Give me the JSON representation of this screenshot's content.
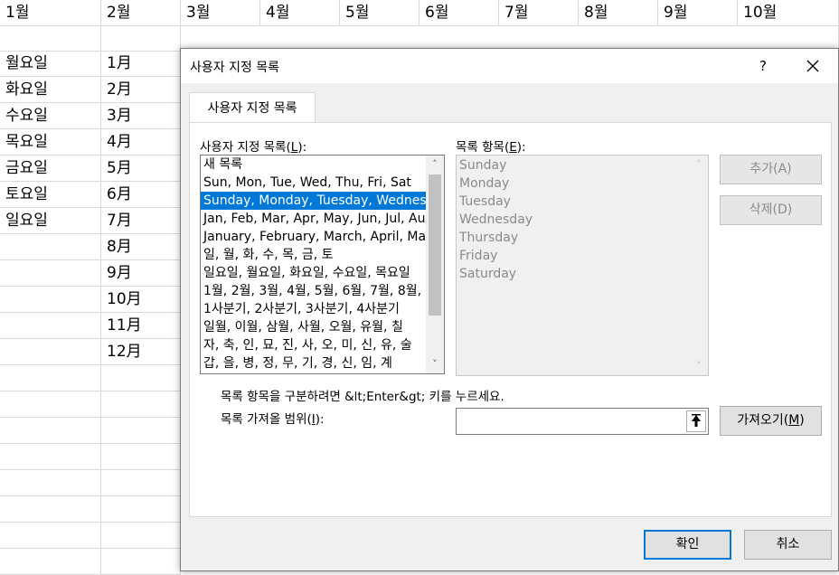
{
  "sheet": {
    "header_row": [
      "1월",
      "2월",
      "3월",
      "4월",
      "5월",
      "6월",
      "7월",
      "8월",
      "9월",
      "10월"
    ],
    "col_a": [
      "월요일",
      "화요일",
      "수요일",
      "목요일",
      "금요일",
      "토요일",
      "일요일"
    ],
    "col_b": [
      "1月",
      "2月",
      "3月",
      "4月",
      "5月",
      "6月",
      "7月",
      "8月",
      "9月",
      "10月",
      "11月",
      "12月"
    ]
  },
  "dialog": {
    "title": "사용자 지정 목록",
    "help": "?",
    "tab": "사용자 지정 목록",
    "lists_label": "사용자 지정 목록(",
    "lists_label_key": "L",
    "lists_label_tail": "):",
    "lists": [
      "새 목록",
      "Sun, Mon, Tue, Wed, Thu, Fri, Sat",
      "Sunday, Monday, Tuesday, Wednesday, Thursday, Friday, Saturday",
      "Jan, Feb, Mar, Apr, May, Jun, Jul, Aug",
      "January, February, March, April, May",
      "일, 월, 화, 수, 목, 금, 토",
      "일요일, 월요일, 화요일, 수요일, 목요일",
      "1월, 2월, 3월, 4월, 5월, 6월, 7월, 8월,",
      "1사분기, 2사분기, 3사분기, 4사분기",
      "일월, 이월, 삼월, 사월, 오월, 유월, 칠",
      "자, 축, 인, 묘, 진, 사, 오, 미, 신, 유, 술",
      "갑, 을, 병, 정, 무, 기, 경, 신, 임, 계"
    ],
    "selected_index": 2,
    "entries_label": "목록 항목(",
    "entries_label_key": "E",
    "entries_label_tail": "):",
    "entries": [
      "Sunday",
      "Monday",
      "Tuesday",
      "Wednesday",
      "Thursday",
      "Friday",
      "Saturday"
    ],
    "add_label": "추가(A)",
    "delete_label": "삭제(D)",
    "hint": "목록 항목을 구분하려면 &lt;Enter&gt; 키를 누르세요.",
    "import_label": "목록 가져올 범위(",
    "import_label_key": "I",
    "import_label_tail": "):",
    "import_value": "",
    "import_button": "가져오기(",
    "import_button_key": "M",
    "import_button_tail": ")",
    "ok_label": "확인",
    "cancel_label": "취소"
  },
  "colors": {
    "selection": "#0078d7",
    "dialog_bg": "#f0f0f0"
  }
}
